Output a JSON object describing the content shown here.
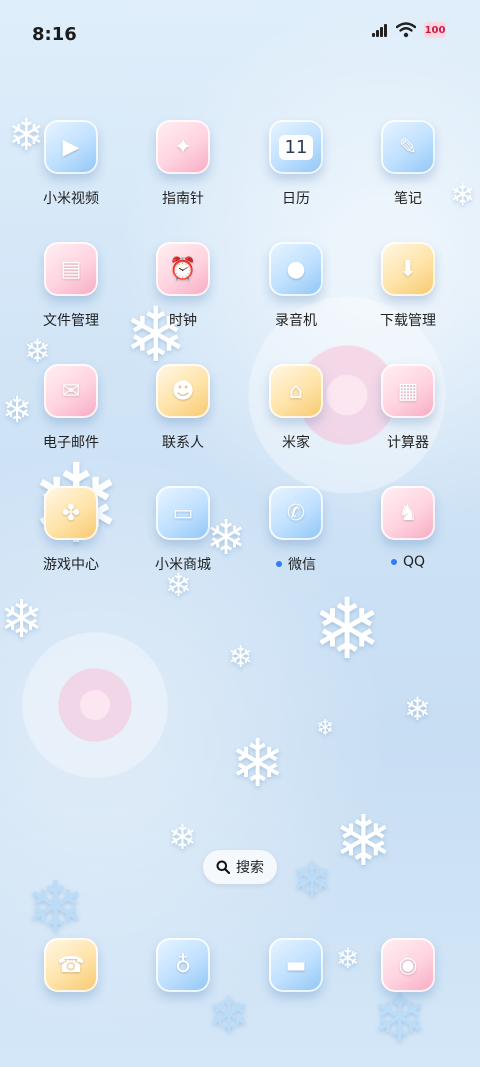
{
  "status_bar": {
    "time": "8:16",
    "battery": "100"
  },
  "apps": [
    {
      "label": "小米视频",
      "icon": "video-icon",
      "glyph": "▶",
      "style": "blue",
      "dot": false
    },
    {
      "label": "指南针",
      "icon": "compass-icon",
      "glyph": "✦",
      "style": "pink",
      "dot": false
    },
    {
      "label": "日历",
      "icon": "calendar-icon",
      "glyph": "11",
      "style": "blue",
      "dot": false
    },
    {
      "label": "笔记",
      "icon": "notes-icon",
      "glyph": "✎",
      "style": "blue",
      "dot": false
    },
    {
      "label": "文件管理",
      "icon": "folder-icon",
      "glyph": "▤",
      "style": "pink",
      "dot": false
    },
    {
      "label": "时钟",
      "icon": "clock-icon",
      "glyph": "⏰",
      "style": "pink",
      "dot": false
    },
    {
      "label": "录音机",
      "icon": "recorder-icon",
      "glyph": "●",
      "style": "blue",
      "dot": false
    },
    {
      "label": "下载管理",
      "icon": "download-icon",
      "glyph": "⬇",
      "style": "yellow",
      "dot": false
    },
    {
      "label": "电子邮件",
      "icon": "mail-icon",
      "glyph": "✉",
      "style": "pink",
      "dot": false
    },
    {
      "label": "联系人",
      "icon": "contacts-icon",
      "glyph": "☻",
      "style": "yellow",
      "dot": false
    },
    {
      "label": "米家",
      "icon": "mihome-icon",
      "glyph": "⌂",
      "style": "yellow",
      "dot": false
    },
    {
      "label": "计算器",
      "icon": "calculator-icon",
      "glyph": "▦",
      "style": "pink",
      "dot": false
    },
    {
      "label": "游戏中心",
      "icon": "gamepad-icon",
      "glyph": "✤",
      "style": "yellow",
      "dot": false
    },
    {
      "label": "小米商城",
      "icon": "store-icon",
      "glyph": "▭",
      "style": "blue",
      "dot": false
    },
    {
      "label": "微信",
      "icon": "wechat-icon",
      "glyph": "✆",
      "style": "blue",
      "dot": true
    },
    {
      "label": "QQ",
      "icon": "qq-icon",
      "glyph": "♞",
      "style": "pink",
      "dot": true
    }
  ],
  "search": {
    "label": "搜索",
    "icon": "search-icon"
  },
  "dock": [
    {
      "icon": "phone-icon",
      "glyph": "☎",
      "style": "yellow"
    },
    {
      "icon": "browser-icon",
      "glyph": "♁",
      "style": "blue"
    },
    {
      "icon": "messages-icon",
      "glyph": "▬",
      "style": "blue"
    },
    {
      "icon": "camera-icon",
      "glyph": "◉",
      "style": "pink"
    }
  ]
}
